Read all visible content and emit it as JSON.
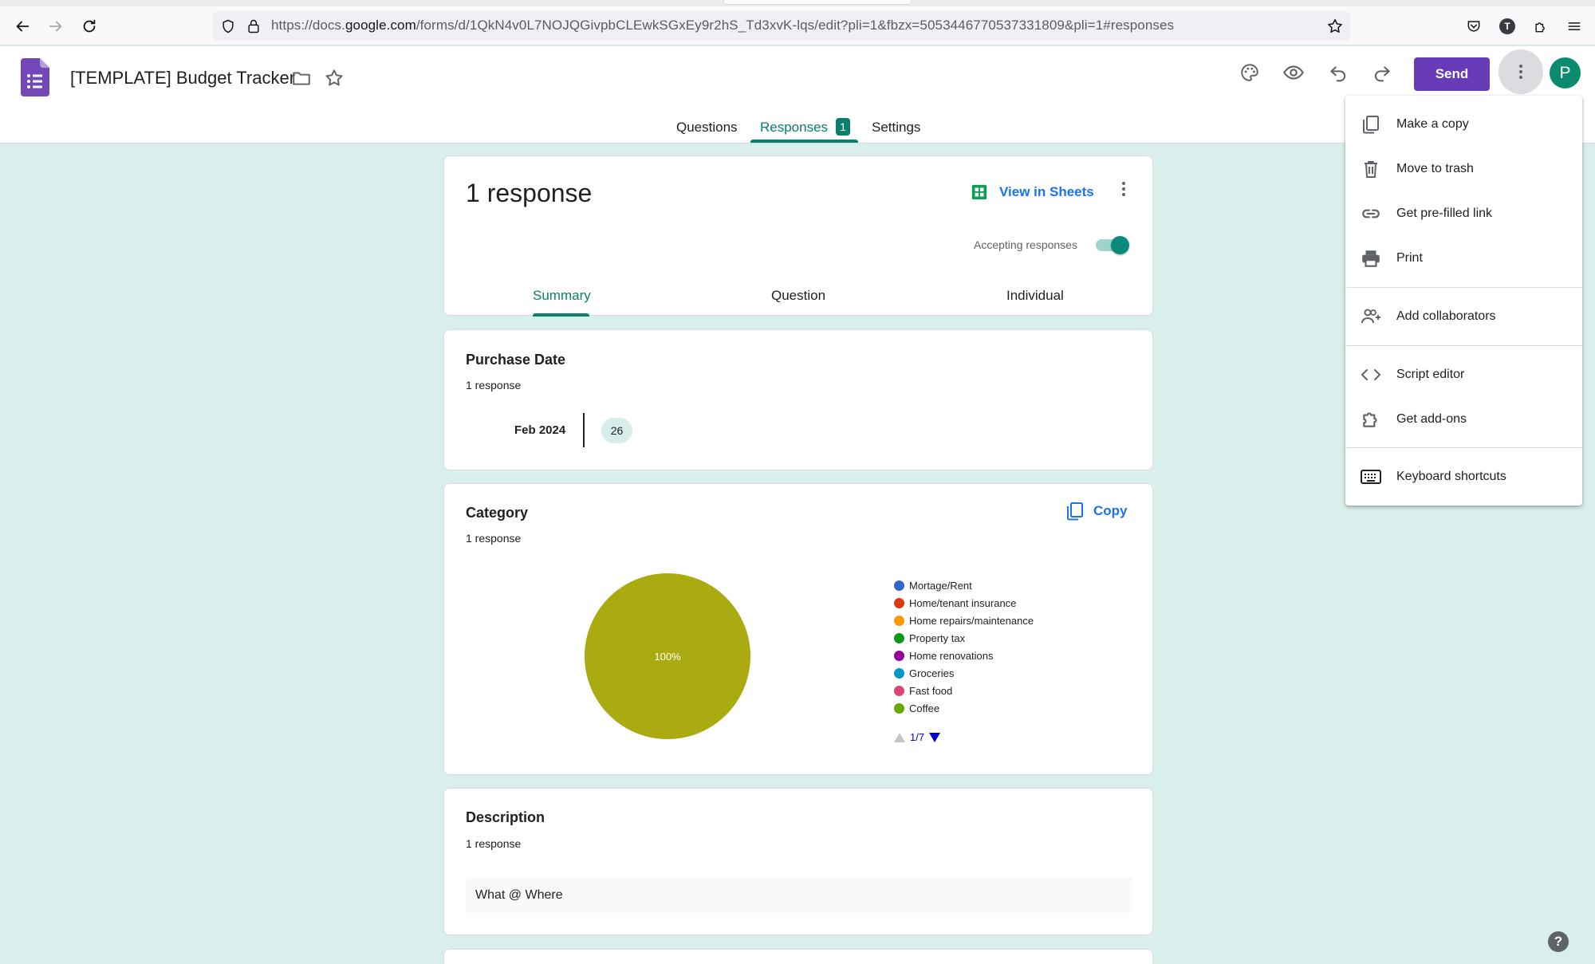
{
  "browser": {
    "url_prefix": "https://docs.",
    "url_domain": "google.com",
    "url_rest": "/forms/d/1QkN4v0L7NOJQGivpbCLEwkSGxEy9r2hS_Td3xvK-lqs/edit?pli=1&fbzx=5053446770537331809&pli=1#responses",
    "profile_initial": "T"
  },
  "header": {
    "title": "[TEMPLATE] Budget Tracker",
    "send_label": "Send",
    "avatar_initial": "P",
    "brand_color": "#673ab7",
    "accent_color": "#0a7f6c"
  },
  "tabs": {
    "questions": "Questions",
    "responses": "Responses",
    "responses_count": "1",
    "settings": "Settings"
  },
  "summary_card": {
    "title": "1 response",
    "view_in_sheets": "View in Sheets",
    "accepting_label": "Accepting responses",
    "accepting": true,
    "subtabs": {
      "summary": "Summary",
      "question": "Question",
      "individual": "Individual"
    }
  },
  "purchase_date": {
    "title": "Purchase Date",
    "count": "1 response",
    "month": "Feb 2024",
    "day": "26"
  },
  "category": {
    "title": "Category",
    "count": "1 response",
    "copy_label": "Copy",
    "pager": "1/7"
  },
  "chart_data": {
    "type": "pie",
    "slices": [
      {
        "label": "Coffee",
        "value": 100,
        "display": "100%",
        "color": "#aaaa11"
      }
    ],
    "legend": [
      {
        "label": "Mortage/Rent",
        "color": "#3366cc"
      },
      {
        "label": "Home/tenant insurance",
        "color": "#dc3912"
      },
      {
        "label": "Home repairs/maintenance",
        "color": "#ff9900"
      },
      {
        "label": "Property tax",
        "color": "#109618"
      },
      {
        "label": "Home renovations",
        "color": "#990099"
      },
      {
        "label": "Groceries",
        "color": "#0099c6"
      },
      {
        "label": "Fast food",
        "color": "#dd4477"
      },
      {
        "label": "Coffee",
        "color": "#66aa00"
      }
    ]
  },
  "description": {
    "title": "Description",
    "count": "1 response",
    "answer": "What @ Where"
  },
  "menu": {
    "make_copy": "Make a copy",
    "move_to_trash": "Move to trash",
    "prefilled_link": "Get pre-filled link",
    "print": "Print",
    "add_collaborators": "Add collaborators",
    "script_editor": "Script editor",
    "get_addons": "Get add-ons",
    "keyboard_shortcuts": "Keyboard shortcuts"
  },
  "help_label": "?"
}
